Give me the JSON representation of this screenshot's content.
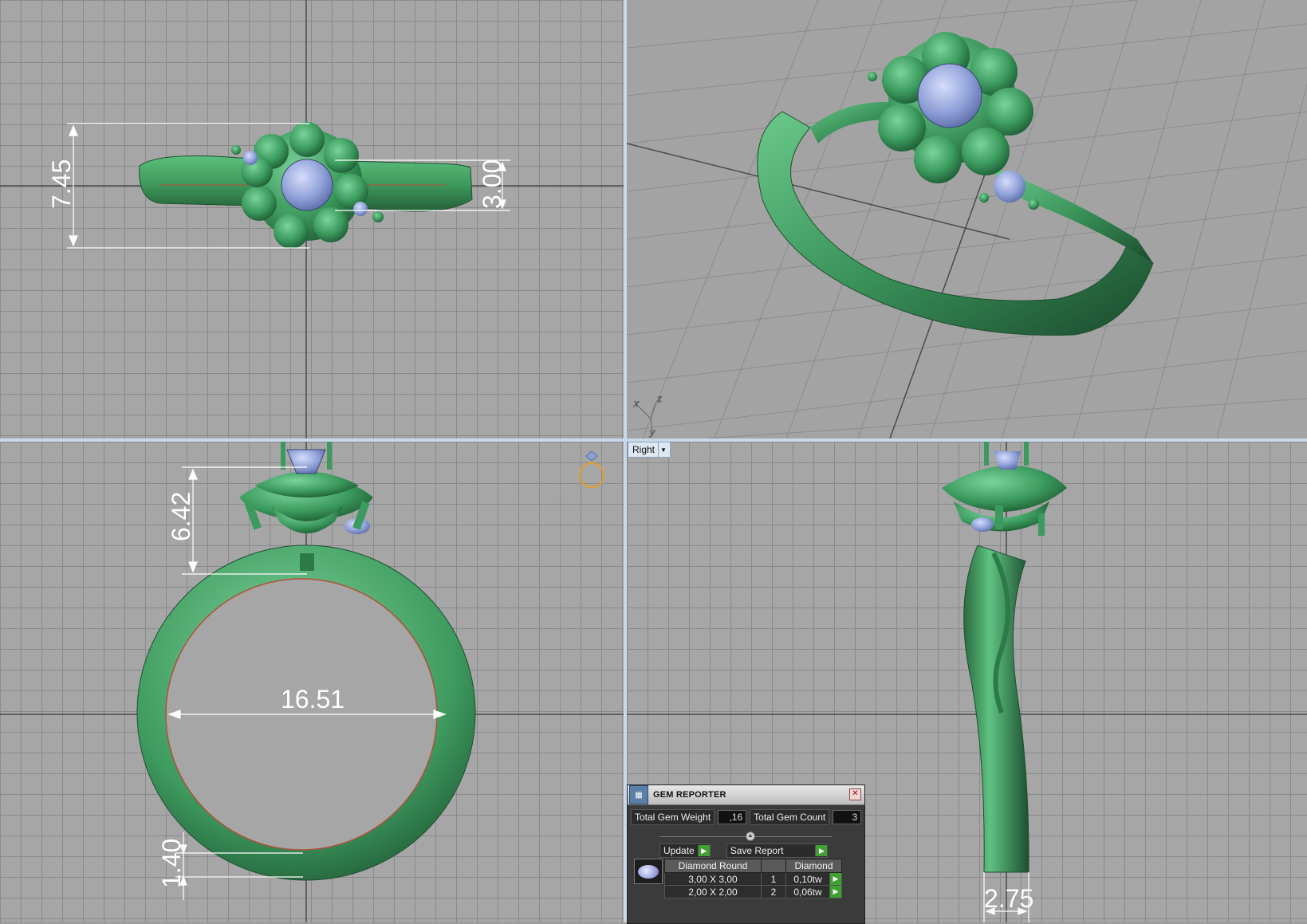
{
  "viewports": {
    "top": {
      "dimensions": {
        "height": "7.45",
        "stone": "3.00"
      }
    },
    "perspective": {
      "axes": {
        "x": "x",
        "y": "y",
        "z": "z"
      }
    },
    "front": {
      "dimensions": {
        "head": "6.42",
        "inner_diameter": "16.51",
        "shank": "1.40"
      }
    },
    "right": {
      "view_label": "Right",
      "dimensions": {
        "width": "2.75"
      }
    }
  },
  "gem_reporter": {
    "title": "GEM REPORTER",
    "total_gem_weight_label": "Total Gem Weight",
    "total_gem_weight": ",16",
    "total_gem_count_label": "Total Gem Count",
    "total_gem_count": "3",
    "update_label": "Update",
    "save_report_label": "Save Report",
    "table": {
      "headers": [
        "Diamond Round",
        "",
        "Diamond"
      ],
      "rows": [
        {
          "size": "3,00 X 3,00",
          "count": "1",
          "weight": "0,10tw"
        },
        {
          "size": "2,00 X 2,00",
          "count": "2",
          "weight": "0,06tw"
        }
      ]
    }
  },
  "colors": {
    "metal": "#3e9a5e",
    "gem": "#8fa0d8",
    "accent_border": "#c9d9ec"
  }
}
